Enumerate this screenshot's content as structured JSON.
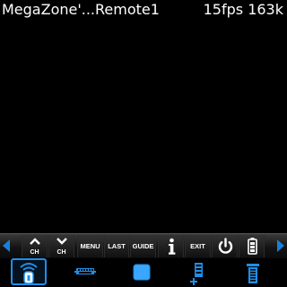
{
  "status": {
    "title": "MegaZone'...Remote1",
    "stats": "15fps 163k"
  },
  "key_bar": {
    "keys": [
      {
        "id": "ch-up",
        "label": "CH",
        "icon": "chevron-up-icon"
      },
      {
        "id": "ch-down",
        "label": "CH",
        "icon": "chevron-down-icon"
      },
      {
        "id": "menu",
        "label": "MENU"
      },
      {
        "id": "last",
        "label": "LAST"
      },
      {
        "id": "guide",
        "label": "GUIDE"
      },
      {
        "id": "info",
        "icon": "info-icon"
      },
      {
        "id": "exit",
        "label": "EXIT"
      },
      {
        "id": "power",
        "icon": "power-icon"
      },
      {
        "id": "battery",
        "icon": "battery-icon"
      }
    ],
    "scroll_left_icon": "arrow-left-icon",
    "scroll_right_icon": "arrow-right-icon"
  },
  "tabs": [
    {
      "id": "remote",
      "icon": "remote-control-icon",
      "active": true
    },
    {
      "id": "keyboard",
      "icon": "keyboard-icon",
      "active": false
    },
    {
      "id": "video",
      "icon": "square-screen-icon",
      "active": false
    },
    {
      "id": "add-device",
      "icon": "add-device-icon",
      "active": false
    },
    {
      "id": "list",
      "icon": "list-icon",
      "active": false
    }
  ],
  "colors": {
    "accent": "#1e8fe8",
    "background": "#000000",
    "key_bar": "#1a1a1a"
  }
}
